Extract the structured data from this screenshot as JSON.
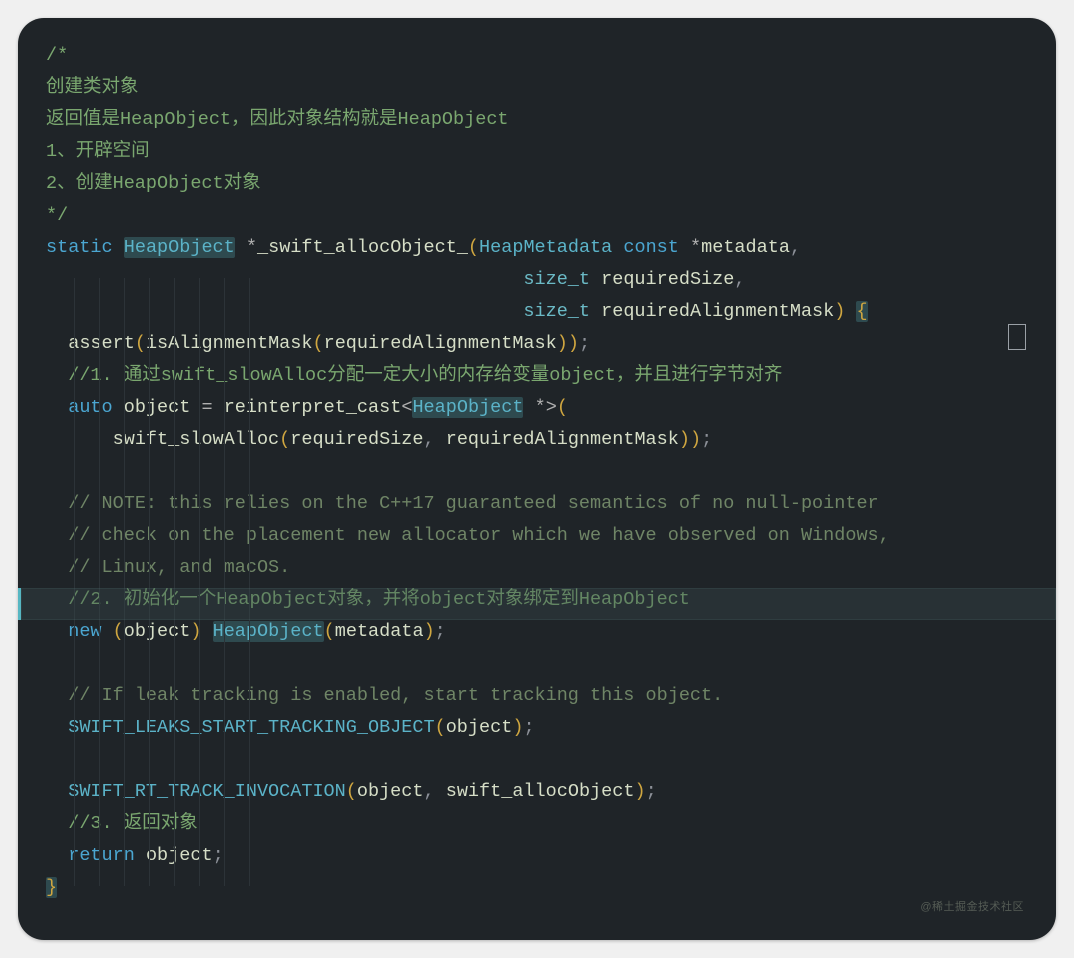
{
  "code": {
    "c_open": "/*",
    "c1": "创建类对象",
    "c2": "返回值是HeapObject，因此对象结构就是HeapObject",
    "c3": "1、开辟空间",
    "c4": "2、创建HeapObject对象",
    "c_close": "*/",
    "kw_static": "static",
    "ty_heapobj": "HeapObject",
    "star": "*",
    "fn_name": "_swift_allocObject_",
    "lp": "(",
    "rp": ")",
    "ty_heapmeta": "HeapMetadata",
    "kw_const": "const",
    "id_metadata": "metadata",
    "comma": ",",
    "ty_sizet": "size_t",
    "id_reqsize": "requiredSize",
    "id_reqalign": "requiredAlignmentMask",
    "lb": "{",
    "rb": "}",
    "fn_assert": "assert",
    "fn_isalign": "isAlignmentMask",
    "semi": ";",
    "cmt_1": "//1. 通过swift_slowAlloc分配一定大小的内存给变量object，并且进行字节对齐",
    "kw_auto": "auto",
    "id_object": "object",
    "eq": "=",
    "fn_reint": "reinterpret_cast",
    "lt": "<",
    "gt": ">",
    "fn_slowalloc": "swift_slowAlloc",
    "cmt_note1": "// NOTE: this relies on the C++17 guaranteed semantics of no null-pointer",
    "cmt_note2": "// check on the placement new allocator which we have observed on Windows,",
    "cmt_note3": "// Linux, and macOS.",
    "cmt_2": "//2. 初始化一个HeapObject对象，并将object对象绑定到HeapObject",
    "kw_new": "new",
    "cmt_leak": "// If leak tracking is enabled, start tracking this object.",
    "mac_leaks": "SWIFT_LEAKS_START_TRACKING_OBJECT",
    "mac_rt": "SWIFT_RT_TRACK_INVOCATION",
    "id_swiftalloc": "swift_allocObject",
    "cmt_3": "//3. 返回对象",
    "kw_return": "return"
  },
  "watermark": "@稀土掘金技术社区"
}
